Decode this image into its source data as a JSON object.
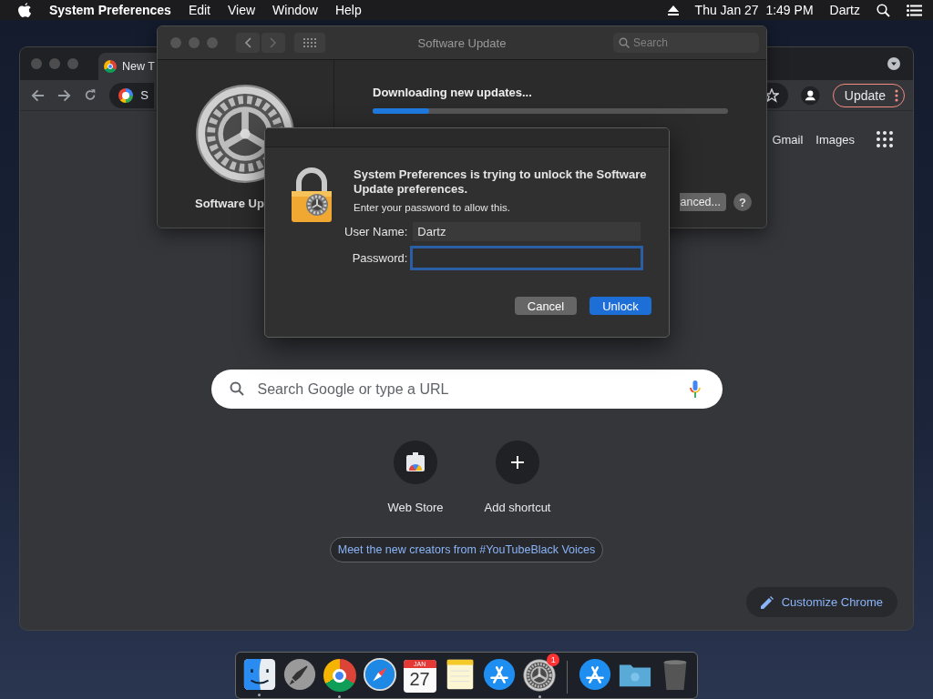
{
  "menu_bar": {
    "app_name": "System Preferences",
    "menus": [
      "Edit",
      "View",
      "Window",
      "Help"
    ],
    "clock": "Thu Jan 27  1:49 PM",
    "user": "Dartz"
  },
  "browser": {
    "tab_title": "New T",
    "address_text": "S",
    "links": [
      "Gmail",
      "Images"
    ],
    "update_button": "Update",
    "search": {
      "placeholder": "Search Google or type a URL"
    },
    "shortcuts": [
      {
        "label": "Web Store",
        "kind": "store"
      },
      {
        "label": "Add shortcut",
        "kind": "add"
      }
    ],
    "promo": "Meet the new creators from #YouTubeBlack Voices",
    "customize_button": "Customize Chrome"
  },
  "software_update": {
    "title": "Software Update",
    "search": {
      "placeholder": "Search"
    },
    "pane_label": "Software Up",
    "status": "Downloading new updates...",
    "progress": {
      "level": 0.16
    },
    "advanced_button": "anced...",
    "help_button": "?"
  },
  "auth_dialog": {
    "heading": "System Preferences is trying to unlock the Software Update preferences.",
    "message": "Enter your password to allow this.",
    "fields": [
      {
        "label": "User Name:",
        "value": "Dartz",
        "focused": false
      },
      {
        "label": "Password:",
        "focused": true
      }
    ],
    "buttons": [
      {
        "label": "Cancel",
        "default": false
      },
      {
        "label": "Unlock",
        "default": true
      }
    ]
  },
  "dock": {
    "apps": [
      {
        "kind": "finder",
        "running": true
      },
      {
        "kind": "launchpad",
        "running": false
      },
      {
        "kind": "chrome",
        "running": true
      },
      {
        "kind": "safari",
        "running": false
      },
      {
        "kind": "calendar",
        "running": false,
        "month": "JAN",
        "day": "27"
      },
      {
        "kind": "notes",
        "running": false
      },
      {
        "kind": "appstore",
        "running": false
      },
      {
        "kind": "settings",
        "running": true,
        "badge": "1"
      },
      {
        "kind": "separator"
      },
      {
        "kind": "appstore",
        "running": false
      },
      {
        "kind": "folder",
        "running": false
      },
      {
        "kind": "trash",
        "running": false
      }
    ]
  }
}
